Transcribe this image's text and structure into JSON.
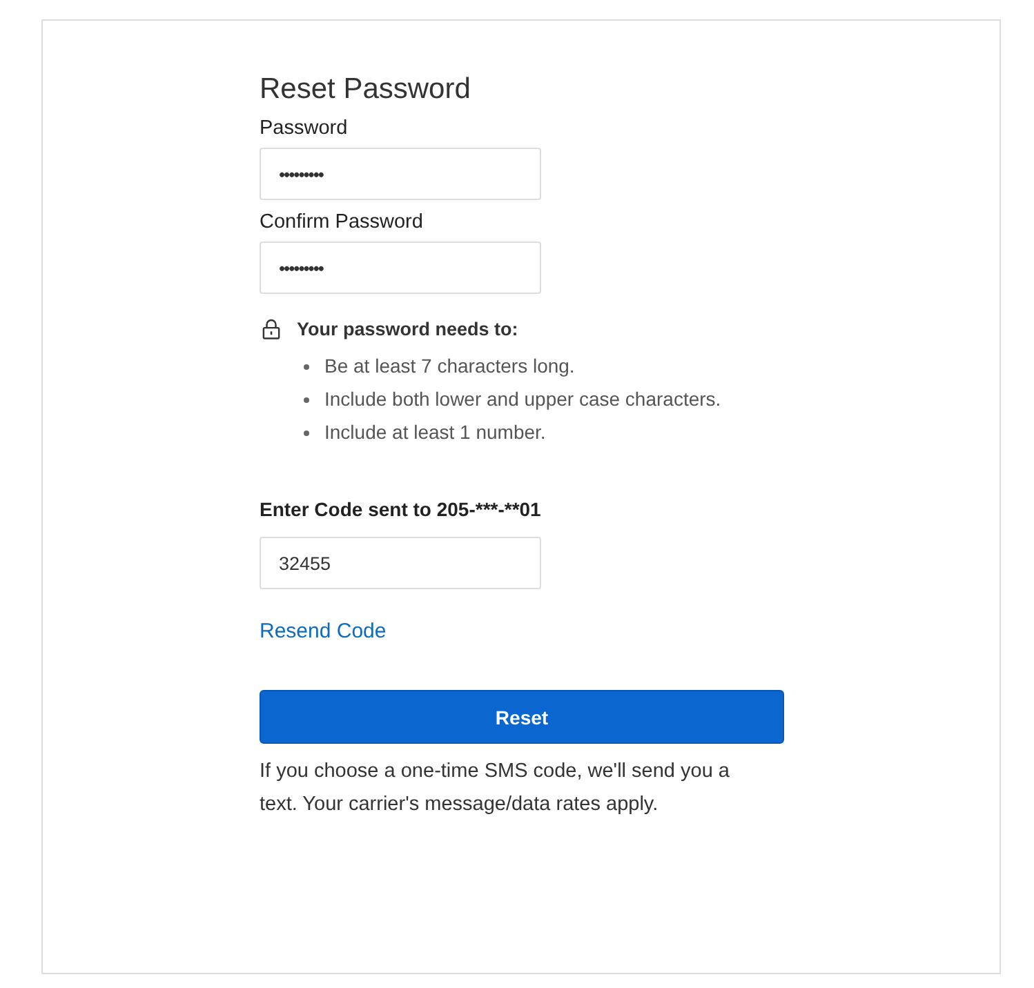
{
  "title": "Reset Password",
  "fields": [
    {
      "label": "Password",
      "value": "•••••••••"
    },
    {
      "label": "Confirm Password",
      "value": "•••••••••"
    }
  ],
  "requirements": {
    "heading": "Your password needs to:",
    "items": [
      "Be at least 7 characters long.",
      "Include both lower and upper case characters.",
      "Include at least 1 number."
    ]
  },
  "code": {
    "label": "Enter Code sent to 205-***-**01",
    "value": "32455"
  },
  "resend_link": "Resend Code",
  "reset_button": "Reset",
  "note": "If you choose a one-time SMS code, we'll send you a text. Your carrier's message/data rates apply."
}
